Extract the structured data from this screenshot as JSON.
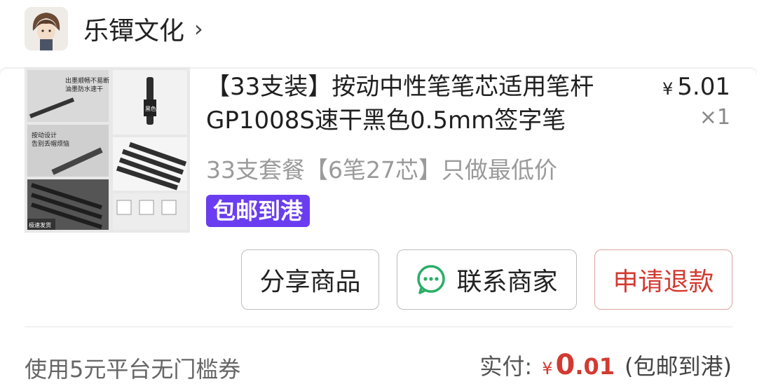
{
  "shop": {
    "name": "乐镡文化",
    "chevron": "›"
  },
  "product": {
    "title_line1": "【33支装】按动中性笔笔芯适用笔杆",
    "title_line2": "GP1008S速干黑色0.5mm签字笔",
    "price_symbol": "¥",
    "price": "5.01",
    "quantity": "×1",
    "spec": "33支套餐【6笔27芯】只做最低价",
    "badge": "包邮到港",
    "thumb_texts": [
      "出墨顺畅不易断",
      "油墨防水速干",
      "按动设计",
      "告别丢帽烦恼",
      "极速发货",
      "黑色"
    ]
  },
  "buttons": {
    "share": "分享商品",
    "contact": "联系商家",
    "refund": "申请退款"
  },
  "footer": {
    "coupon": "使用5元平台无门槛券",
    "paid_label": "实付:",
    "currency": "¥",
    "amount_int": "0",
    "amount_dec": ".01",
    "shipping_note": "(包邮到港)"
  },
  "colors": {
    "accent_red": "#d23a30",
    "badge_purple": "#6a3df0",
    "chat_green": "#2aae67"
  }
}
